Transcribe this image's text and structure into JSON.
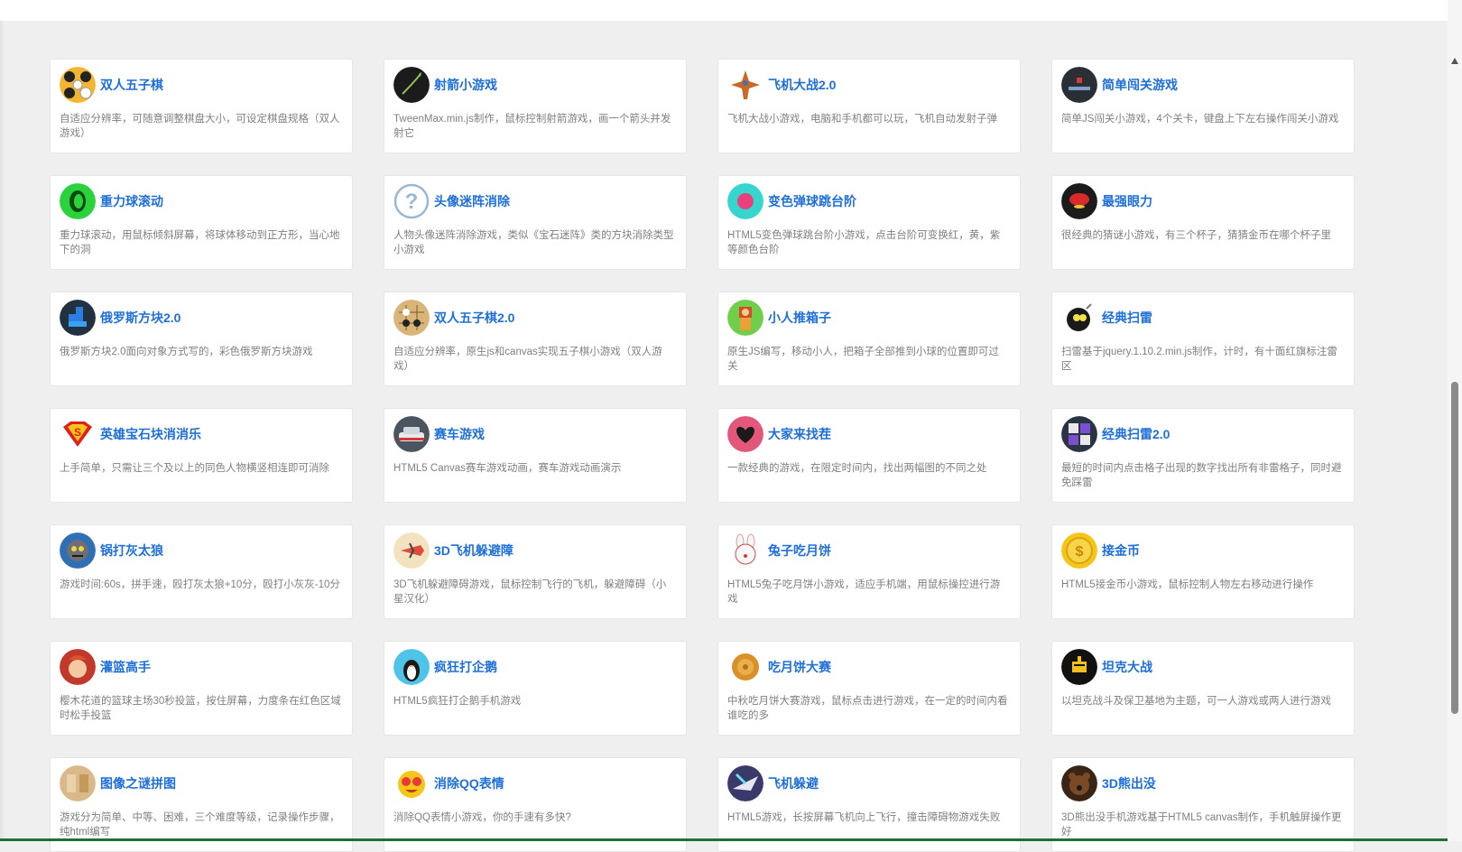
{
  "colors": {
    "background": "#efefef",
    "card": "#ffffff",
    "title": "#1e6fd9",
    "description": "#808080"
  },
  "games": [
    {
      "title": "双人五子棋",
      "desc": "自适应分辨率，可随意调整棋盘大小，可设定棋盘规格（双人游戏）",
      "icon": "gomoku-icon"
    },
    {
      "title": "射箭小游戏",
      "desc": "TweenMax.min.js制作，鼠标控制射箭游戏，画一个箭头并发射它",
      "icon": "arrow-icon"
    },
    {
      "title": "飞机大战2.0",
      "desc": "飞机大战小游戏，电脑和手机都可以玩，飞机自动发射子弹",
      "icon": "plane-icon"
    },
    {
      "title": "简单闯关游戏",
      "desc": "简单JS闯关小游戏，4个关卡，键盘上下左右操作闯关小游戏",
      "icon": "level-icon"
    },
    {
      "title": "重力球滚动",
      "desc": "重力球滚动，用鼠标倾斜屏幕，将球体移动到正方形，当心地下的洞",
      "icon": "gravity-ball-icon"
    },
    {
      "title": "头像迷阵消除",
      "desc": "人物头像迷阵消除游戏，类似《宝石迷阵》类的方块消除类型小游戏",
      "icon": "question-mark-icon"
    },
    {
      "title": "变色弹球跳台阶",
      "desc": "HTML5变色弹球跳台阶小游戏，点击台阶可变换红，黄，紫等颜色台阶",
      "icon": "bounce-ball-icon"
    },
    {
      "title": "最强眼力",
      "desc": "很经典的猜谜小游戏，有三个杯子，猜猜金币在哪个杯子里",
      "icon": "cup-icon"
    },
    {
      "title": "俄罗斯方块2.0",
      "desc": "俄罗斯方块2.0面向对象方式写的，彩色俄罗斯方块游戏",
      "icon": "tetris-icon"
    },
    {
      "title": "双人五子棋2.0",
      "desc": "自适应分辨率，原生js和canvas实现五子棋小游戏（双人游戏）",
      "icon": "gomoku-board-icon"
    },
    {
      "title": "小人推箱子",
      "desc": "原生JS编写，移动小人，把箱子全部推到小球的位置即可过关",
      "icon": "sokoban-icon"
    },
    {
      "title": "经典扫雷",
      "desc": "扫雷基于jquery.1.10.2.min.js制作，计时，有十面红旗标注雷区",
      "icon": "bomb-icon"
    },
    {
      "title": "英雄宝石块消消乐",
      "desc": "上手简单，只需让三个及以上的同色人物横竖相连即可消除",
      "icon": "superman-icon"
    },
    {
      "title": "赛车游戏",
      "desc": "HTML5 Canvas赛车游戏动画，赛车游戏动画演示",
      "icon": "race-car-icon"
    },
    {
      "title": "大家来找茬",
      "desc": "一款经典的游戏，在限定时间内，找出两幅图的不同之处",
      "icon": "heart-icon"
    },
    {
      "title": "经典扫雷2.0",
      "desc": "最短的时间内点击格子出现的数字找出所有非雷格子，同时避免踩雷",
      "icon": "minesweeper-icon"
    },
    {
      "title": "锅打灰太狼",
      "desc": "游戏时间:60s，拼手速，殴打灰太狼+10分，殴打小灰灰-10分",
      "icon": "wolf-icon"
    },
    {
      "title": "3D飞机躲避障",
      "desc": "3D飞机躲避障碍游戏，鼠标控制飞行的飞机，躲避障碍（小星汉化）",
      "icon": "3d-plane-icon"
    },
    {
      "title": "兔子吃月饼",
      "desc": "HTML5兔子吃月饼小游戏，适应手机端，用鼠标操控进行游戏",
      "icon": "rabbit-icon"
    },
    {
      "title": "接金币",
      "desc": "HTML5接金币小游戏，鼠标控制人物左右移动进行操作",
      "icon": "coin-icon"
    },
    {
      "title": "灌篮高手",
      "desc": "樱木花道的篮球主场30秒投篮，按住屏幕，力度条在红色区域时松手投篮",
      "icon": "basketball-icon"
    },
    {
      "title": "疯狂打企鹅",
      "desc": "HTML5疯狂打企鹅手机游戏",
      "icon": "penguin-icon"
    },
    {
      "title": "吃月饼大赛",
      "desc": "中秋吃月饼大赛游戏，鼠标点击进行游戏，在一定的时间内看谁吃的多",
      "icon": "mooncake-icon"
    },
    {
      "title": "坦克大战",
      "desc": "以坦克战斗及保卫基地为主题，可一人游戏或两人进行游戏",
      "icon": "tank-icon"
    },
    {
      "title": "图像之谜拼图",
      "desc": "游戏分为简单、中等、困难，三个难度等级，记录操作步骤，纯html编写",
      "icon": "puzzle-icon"
    },
    {
      "title": "消除QQ表情",
      "desc": "消除QQ表情小游戏，你的手速有多快?",
      "icon": "qq-emoji-icon"
    },
    {
      "title": "飞机躲避",
      "desc": "HTML5游戏，长按屏幕飞机向上飞行，撞击障碍物游戏失败",
      "icon": "jet-icon"
    },
    {
      "title": "3D熊出没",
      "desc": "3D熊出没手机游戏基于HTML5 canvas制作，手机触屏操作更好",
      "icon": "bear-icon"
    }
  ]
}
